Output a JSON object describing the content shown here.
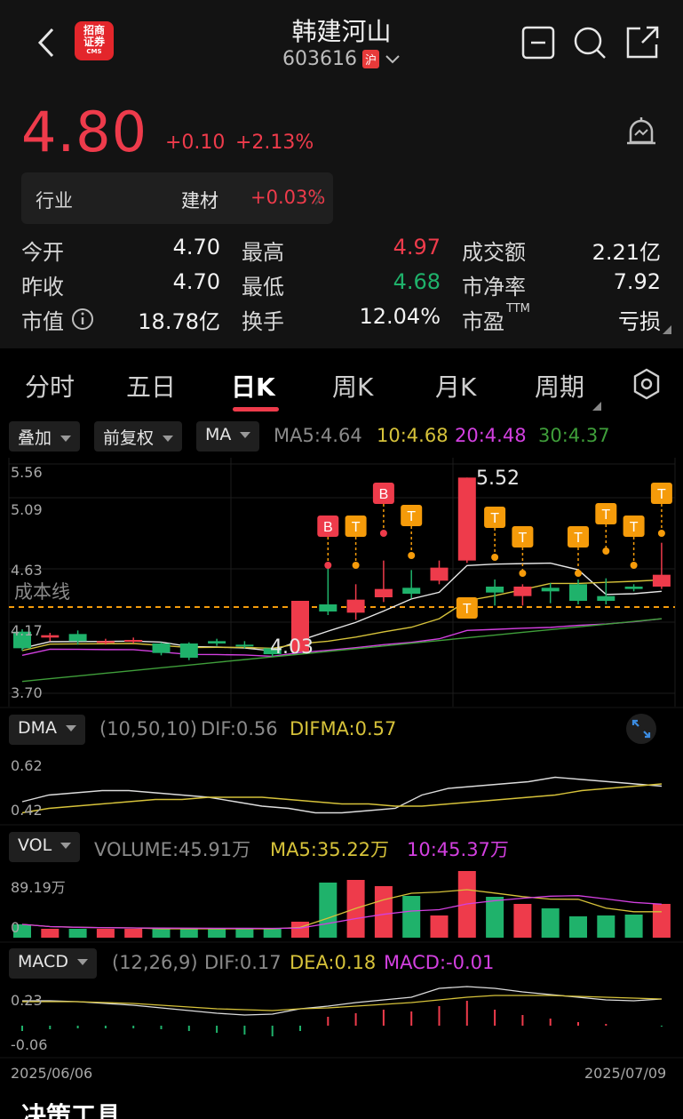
{
  "header": {
    "title": "韩建河山",
    "code": "603616",
    "exchange": "沪",
    "logo_text": "招商证券",
    "logo_sub": "CMS"
  },
  "quote": {
    "price": "4.80",
    "change": "+0.10",
    "change_pct": "+2.13%"
  },
  "industry": {
    "label": "行业",
    "name": "建材",
    "pct": "+0.03%"
  },
  "stats": [
    {
      "label": "今开",
      "value": "4.70",
      "color": "white"
    },
    {
      "label": "最高",
      "value": "4.97",
      "color": "red"
    },
    {
      "label": "成交额",
      "value": "2.21亿",
      "color": "white"
    },
    {
      "label": "昨收",
      "value": "4.70",
      "color": "white"
    },
    {
      "label": "最低",
      "value": "4.68",
      "color": "green"
    },
    {
      "label": "市净率",
      "value": "7.92",
      "color": "white"
    },
    {
      "label": "市值",
      "value": "18.78亿",
      "color": "white"
    },
    {
      "label": "换手",
      "value": "12.04%",
      "color": "white"
    },
    {
      "label": "市盈",
      "value": "亏损",
      "color": "white"
    }
  ],
  "pe_sup": "TTM",
  "tabs": [
    "分时",
    "五日",
    "日K",
    "周K",
    "月K",
    "周期"
  ],
  "dropdowns": {
    "overlay": "叠加",
    "adjust": "前复权",
    "ma": "MA"
  },
  "ma_legend": {
    "ma5": "MA5:4.64",
    "ma10": "10:4.68",
    "ma20": "20:4.48",
    "ma30": "30:4.37"
  },
  "kline_axis": {
    "top": "5.56",
    "mid1": "5.09",
    "mid2": "4.63",
    "mid3": "4.17",
    "bottom": "3.70"
  },
  "cost_line_label": "成本线",
  "high_label": "5.52",
  "low_label": "4.03",
  "dma": {
    "name": "DMA",
    "params": "(10,50,10)",
    "dif": "DIF:0.56",
    "difma": "DIFMA:0.57",
    "axis_top": "0.62",
    "axis_bottom": "0.42"
  },
  "vol": {
    "name": "VOL",
    "volume": "VOLUME:45.91万",
    "ma5": "MA5:35.22万",
    "ma10": "10:45.37万",
    "axis_top": "89.19万",
    "axis_bottom": "0"
  },
  "macd": {
    "name": "MACD",
    "params": "(12,26,9)",
    "dif": "DIF:0.17",
    "dea": "DEA:0.18",
    "macd": "MACD:-0.01",
    "axis_top": "0.23",
    "axis_bottom": "-0.06"
  },
  "dates": {
    "start": "2025/06/06",
    "end": "2025/07/09"
  },
  "footer_text": "决策工具",
  "colors": {
    "up": "#ee3b4b",
    "down": "#1fb26b",
    "ma5": "#e8e8e8",
    "ma10": "#d6c23a",
    "ma20": "#d340e0",
    "ma30": "#3f9e3a",
    "marker": "#f59b0a"
  }
}
